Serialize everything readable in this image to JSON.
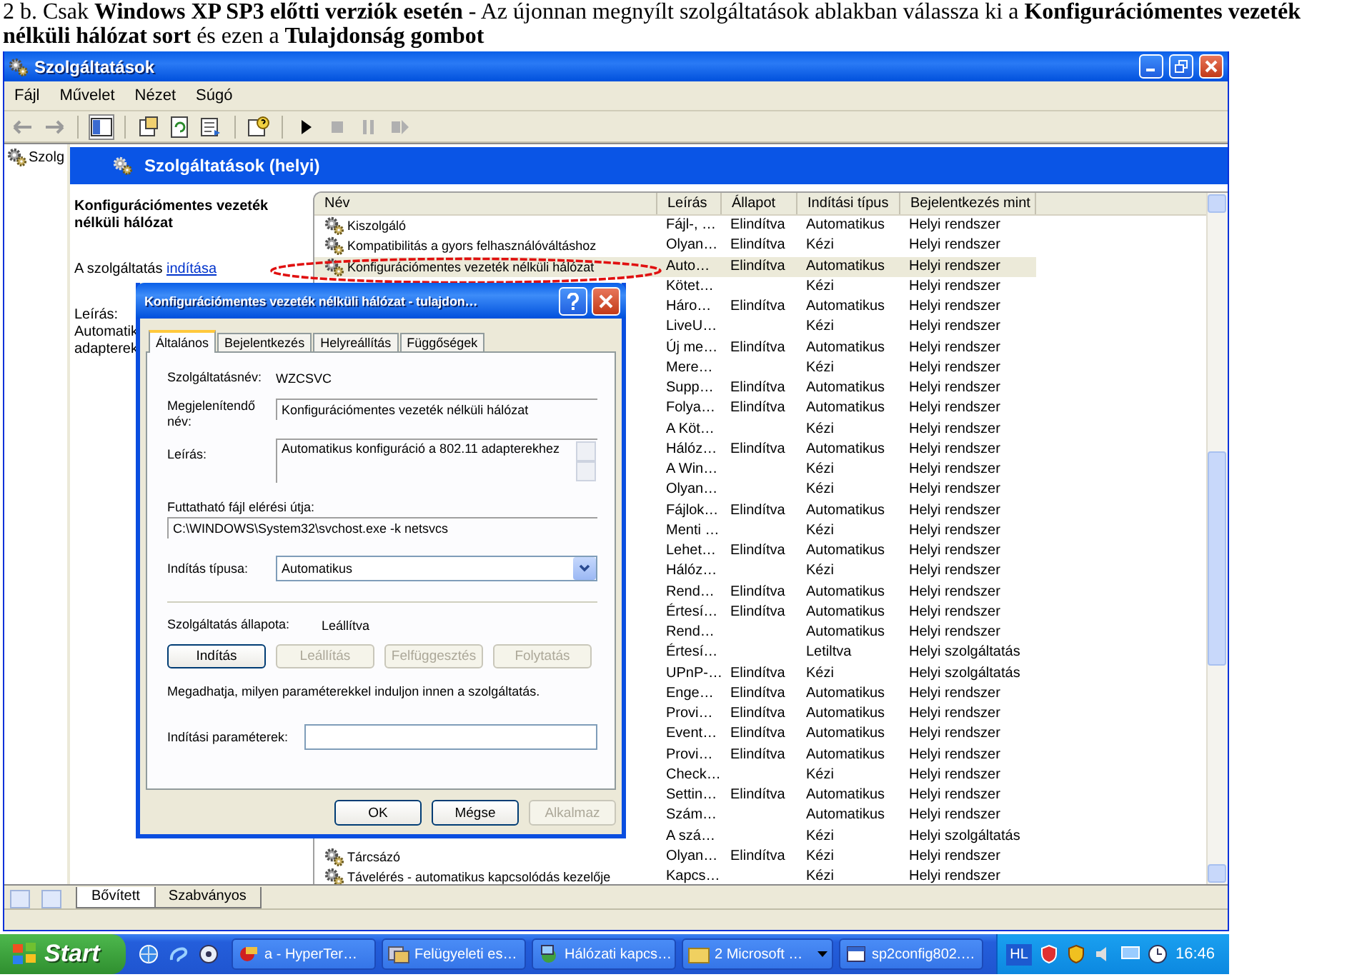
{
  "caption": "2 b. Csak **Windows XP SP3 előtti verziók esetén** - Az újonnan megnyílt szolgáltatások ablakban  válassza ki a **Konfigurációmentes vezeték nélküli hálózat sort** és ezen a **Tulajdonság gombot**",
  "window": {
    "title": "Szolgáltatások",
    "menu": [
      "Fájl",
      "Művelet",
      "Nézet",
      "Súgó"
    ]
  },
  "tree": {
    "items": [
      {
        "label": "Szolg"
      }
    ]
  },
  "pane_header": "Szolgáltatások (helyi)",
  "details": {
    "heading": "Konfigurációmentes vezeték nélküli hálózat",
    "action_prefix": "A szolgáltatás",
    "action_link": "indítása",
    "description_label": "Leírás:",
    "description_lines": [
      "Automatik",
      "adapterek"
    ]
  },
  "table": {
    "columns": [
      "Név",
      "Leírás",
      "Állapot",
      "Indítási típus",
      "Bejelentkezés mint"
    ],
    "rows": [
      {
        "name": "Kiszolgáló",
        "description": "Fájl-, …",
        "status": "Elindítva",
        "startup": "Automatikus",
        "logon": "Helyi rendszer",
        "selected": false
      },
      {
        "name": "Kompatibilitás a gyors felhasználóváltáshoz",
        "description": "Olyan…",
        "status": "Elindítva",
        "startup": "Kézi",
        "logon": "Helyi rendszer",
        "selected": false
      },
      {
        "name": "Konfigurációmentes vezeték nélküli hálózat",
        "description": "Auto…",
        "status": "Elindítva",
        "startup": "Automatikus",
        "logon": "Helyi rendszer",
        "selected": true
      },
      {
        "description": "Kötet…",
        "startup": "Kézi",
        "logon": "Helyi rendszer",
        "selected": false
      },
      {
        "description": "Háro…",
        "status": "Elindítva",
        "startup": "Automatikus",
        "logon": "Helyi rendszer",
        "selected": false
      },
      {
        "description": "LiveU…",
        "startup": "Kézi",
        "logon": "Helyi rendszer",
        "selected": false
      },
      {
        "description": "Új me…",
        "status": "Elindítva",
        "startup": "Automatikus",
        "logon": "Helyi rendszer",
        "selected": false
      },
      {
        "description": "Mere…",
        "startup": "Kézi",
        "logon": "Helyi rendszer",
        "selected": false
      },
      {
        "description": "Supp…",
        "status": "Elindítva",
        "startup": "Automatikus",
        "logon": "Helyi rendszer",
        "selected": false
      },
      {
        "description": "Folya…",
        "status": "Elindítva",
        "startup": "Automatikus",
        "logon": "Helyi rendszer",
        "selected": false
      },
      {
        "description": "A Köt…",
        "startup": "Kézi",
        "logon": "Helyi rendszer",
        "selected": false
      },
      {
        "description": "Hálóz…",
        "status": "Elindítva",
        "startup": "Automatikus",
        "logon": "Helyi rendszer",
        "selected": false
      },
      {
        "description": "A Win…",
        "startup": "Kézi",
        "logon": "Helyi rendszer",
        "selected": false
      },
      {
        "description": "Olyan…",
        "startup": "Kézi",
        "logon": "Helyi rendszer",
        "selected": false
      },
      {
        "description": "Fájlok…",
        "status": "Elindítva",
        "startup": "Automatikus",
        "logon": "Helyi rendszer",
        "selected": false
      },
      {
        "description": "Menti …",
        "startup": "Kézi",
        "logon": "Helyi rendszer",
        "selected": false
      },
      {
        "description": "Lehet…",
        "status": "Elindítva",
        "startup": "Automatikus",
        "logon": "Helyi rendszer",
        "selected": false
      },
      {
        "description": "Hálóz…",
        "startup": "Kézi",
        "logon": "Helyi rendszer",
        "selected": false
      },
      {
        "description": "Rend…",
        "status": "Elindítva",
        "startup": "Automatikus",
        "logon": "Helyi rendszer",
        "selected": false
      },
      {
        "description": "Értesí…",
        "status": "Elindítva",
        "startup": "Automatikus",
        "logon": "Helyi rendszer",
        "selected": false
      },
      {
        "description": "Rend…",
        "startup": "Automatikus",
        "logon": "Helyi rendszer",
        "selected": false
      },
      {
        "description": "Értesí…",
        "startup": "Letiltva",
        "logon": "Helyi szolgáltatás",
        "selected": false
      },
      {
        "description": "UPnP-…",
        "status": "Elindítva",
        "startup": "Kézi",
        "logon": "Helyi szolgáltatás",
        "selected": false
      },
      {
        "description": "Enge…",
        "status": "Elindítva",
        "startup": "Automatikus",
        "logon": "Helyi rendszer",
        "selected": false
      },
      {
        "description": "Provi…",
        "status": "Elindítva",
        "startup": "Automatikus",
        "logon": "Helyi rendszer",
        "selected": false
      },
      {
        "description": "Event…",
        "status": "Elindítva",
        "startup": "Automatikus",
        "logon": "Helyi rendszer",
        "selected": false
      },
      {
        "description": "Provi…",
        "status": "Elindítva",
        "startup": "Automatikus",
        "logon": "Helyi rendszer",
        "selected": false
      },
      {
        "description": "Check…",
        "startup": "Kézi",
        "logon": "Helyi rendszer",
        "selected": false
      },
      {
        "description": "Settin…",
        "status": "Elindítva",
        "startup": "Automatikus",
        "logon": "Helyi rendszer",
        "selected": false
      },
      {
        "description": "Szám…",
        "startup": "Automatikus",
        "logon": "Helyi rendszer",
        "selected": false
      },
      {
        "description": "A szá…",
        "startup": "Kézi",
        "logon": "Helyi szolgáltatás",
        "selected": false
      },
      {
        "name": "Tárcsázó",
        "description": "Olyan…",
        "status": "Elindítva",
        "startup": "Kézi",
        "logon": "Helyi rendszer",
        "selected": false
      },
      {
        "name": "Távelérés - automatikus kapcsolódás kezelője",
        "description": "Kapcs…",
        "startup": "Kézi",
        "logon": "Helyi rendszer",
        "selected": false
      }
    ]
  },
  "bottom_tabs": [
    {
      "label": "Bővített",
      "selected": true
    },
    {
      "label": "Szabványos",
      "selected": false
    }
  ],
  "dialog": {
    "title": "Konfigurációmentes vezeték nélküli hálózat - tulajdon…",
    "tabs": [
      {
        "label": "Általános",
        "selected": true
      },
      {
        "label": "Bejelentkezés",
        "selected": false
      },
      {
        "label": "Helyreállítás",
        "selected": false
      },
      {
        "label": "Függőségek",
        "selected": false
      }
    ],
    "service_name": {
      "label": "Szolgáltatásnév:",
      "value": "WZCSVC"
    },
    "display_name": {
      "label": "Megjelenítendő név:",
      "value": "Konfigurációmentes vezeték nélküli hálózat"
    },
    "description": {
      "label": "Leírás:",
      "value": "Automatikus konfiguráció a 802.11 adapterekhez"
    },
    "path": {
      "label": "Futtatható fájl elérési útja:",
      "value": "C:\\WINDOWS\\System32\\svchost.exe -k netsvcs"
    },
    "startup_type": {
      "label": "Indítás típusa:",
      "value": "Automatikus"
    },
    "status": {
      "label": "Szolgáltatás állapota:",
      "value": "Leállítva"
    },
    "service_buttons": [
      {
        "label": "Indítás",
        "disabled": false
      },
      {
        "label": "Leállítás",
        "disabled": true
      },
      {
        "label": "Felfüggesztés",
        "disabled": true
      },
      {
        "label": "Folytatás",
        "disabled": true
      }
    ],
    "hint": "Megadhatja, milyen paraméterekkel induljon innen a szolgáltatás.",
    "parameters": {
      "label": "Indítási paraméterek:"
    },
    "buttons": [
      {
        "label": "OK",
        "disabled": false
      },
      {
        "label": "Mégse",
        "disabled": false
      },
      {
        "label": "Alkalmaz",
        "disabled": true
      }
    ]
  },
  "taskbar": {
    "start": "Start",
    "tasks": [
      {
        "label": "a - HyperTer…",
        "kind": "single"
      },
      {
        "label": "Felügyeleti es…",
        "kind": "single"
      },
      {
        "label": "Hálózati kapcs…",
        "kind": "single"
      },
      {
        "label": "2 Microsoft …",
        "kind": "group"
      },
      {
        "label": "sp2config802.…",
        "kind": "single"
      }
    ],
    "language": "HL",
    "clock": "16:46"
  }
}
